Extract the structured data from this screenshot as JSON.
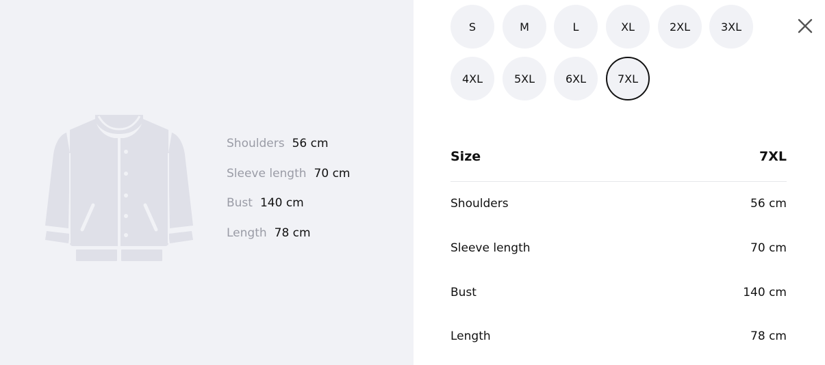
{
  "product_image": {
    "icon": "jacket-icon"
  },
  "measurements_summary": [
    {
      "label": "Shoulders",
      "value": "56 cm"
    },
    {
      "label": "Sleeve length",
      "value": "70 cm"
    },
    {
      "label": "Bust",
      "value": "140 cm"
    },
    {
      "label": "Length",
      "value": "78 cm"
    }
  ],
  "sizes": [
    "S",
    "M",
    "L",
    "XL",
    "2XL",
    "3XL",
    "4XL",
    "5XL",
    "6XL",
    "7XL"
  ],
  "selected_size": "7XL",
  "close_icon": "close-icon",
  "size_table": {
    "header_label": "Size",
    "header_value": "7XL",
    "rows": [
      {
        "label": "Shoulders",
        "value": "56 cm"
      },
      {
        "label": "Sleeve length",
        "value": "70 cm"
      },
      {
        "label": "Bust",
        "value": "140 cm"
      },
      {
        "label": "Length",
        "value": "78 cm"
      }
    ]
  },
  "colors": {
    "panel_bg": "#f1f2f6",
    "jacket_fill": "#dfe0e8",
    "muted_text": "#9a9ca6",
    "text": "#111111",
    "divider": "#e6e7eb"
  }
}
